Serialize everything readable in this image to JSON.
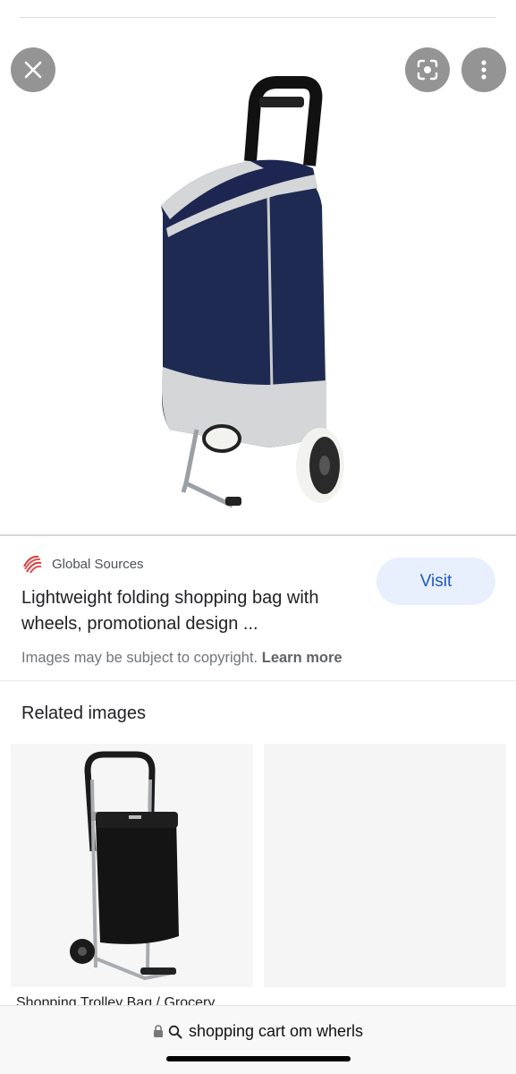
{
  "toolbar": {
    "close_icon": "close-icon",
    "lens_icon": "lens-icon",
    "more_icon": "more-vert-icon"
  },
  "result": {
    "source_name": "Global Sources",
    "source_logo": "global-sources-logo",
    "title": "Lightweight folding shopping bag with wheels, promotional design ...",
    "visit_label": "Visit",
    "copyright_text": "Images may be subject to copyright.",
    "learn_more_label": "Learn more"
  },
  "related": {
    "title": "Related images",
    "items": [
      {
        "caption": "Shopping Trolley Bag / Grocery"
      },
      {
        "caption": ""
      }
    ]
  },
  "address_bar": {
    "lock_icon": "lock-icon",
    "search_icon": "search-icon",
    "url_text": "shopping cart om wherls"
  },
  "colors": {
    "visit_bg": "#e8f0fe",
    "visit_text": "#1a56c8",
    "bag_navy": "#1f2a52",
    "bag_trim": "#d4d6d8"
  }
}
